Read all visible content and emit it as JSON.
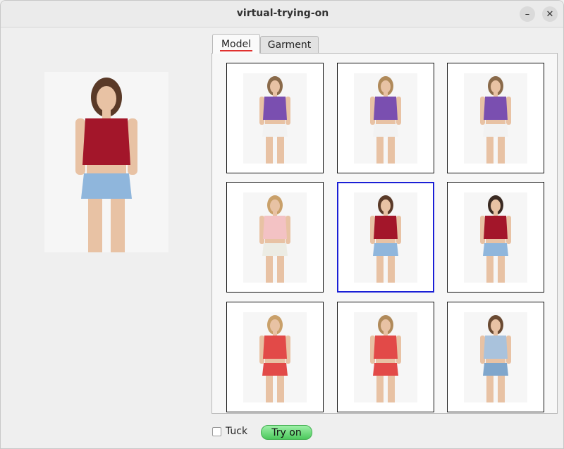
{
  "window": {
    "title": "virtual-trying-on",
    "minimize_glyph": "–",
    "close_glyph": "✕"
  },
  "tabs": [
    {
      "label": "Model",
      "active": true
    },
    {
      "label": "Garment",
      "active": false
    }
  ],
  "models": [
    {
      "top": "#7a4fb0",
      "bottom": "#f2f2f2",
      "hair": "#8a6a4a",
      "selected": false
    },
    {
      "top": "#7a4fb0",
      "bottom": "#f2f2f2",
      "hair": "#b08a5a",
      "selected": false
    },
    {
      "top": "#7a4fb0",
      "bottom": "#f2f2f2",
      "hair": "#8a6a4a",
      "selected": false
    },
    {
      "top": "#f3c2c4",
      "bottom": "#ecece4",
      "hair": "#c9a06a",
      "selected": false
    },
    {
      "top": "#a3162a",
      "bottom": "#8fb6dc",
      "hair": "#5a3a28",
      "selected": true
    },
    {
      "top": "#a3162a",
      "bottom": "#8fb6dc",
      "hair": "#3a2a22",
      "selected": false
    },
    {
      "top": "#e24a48",
      "bottom": "#e24a48",
      "hair": "#c9a06a",
      "selected": false
    },
    {
      "top": "#e24a48",
      "bottom": "#e24a48",
      "hair": "#b08a5a",
      "selected": false
    },
    {
      "top": "#a9c2dc",
      "bottom": "#7fa6cc",
      "hair": "#6a4a32",
      "selected": false
    }
  ],
  "preview": {
    "top": "#a3162a",
    "bottom": "#8fb6dc",
    "hair": "#5a3a28"
  },
  "footer": {
    "tuck_label": "Tuck",
    "tuck_checked": false,
    "tryon_label": "Try on"
  }
}
